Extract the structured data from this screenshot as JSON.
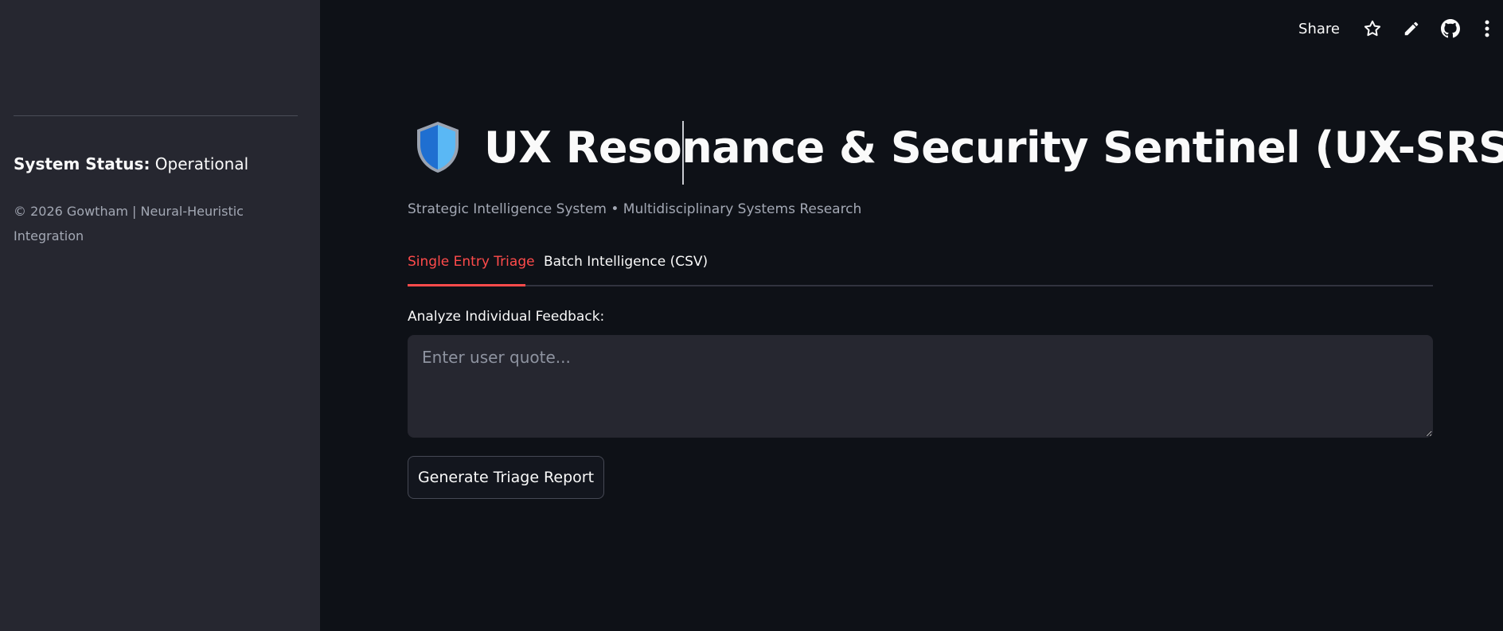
{
  "sidebar": {
    "status_label": "System Status:",
    "status_value": "Operational",
    "copyright": "© 2026 Gowtham | Neural-Heuristic Integration"
  },
  "toolbar": {
    "share_label": "Share",
    "icons": [
      "star-icon",
      "pencil-icon",
      "github-icon",
      "more-vertical-icon"
    ]
  },
  "main": {
    "title_icon": "shield-icon",
    "title": "UX Resonance & Security Sentinel (UX-SRS)",
    "subtitle": "Strategic Intelligence System • Multidisciplinary Systems Research",
    "tabs": [
      {
        "label": "Single Entry Triage",
        "active": true
      },
      {
        "label": "Batch Intelligence (CSV)",
        "active": false
      }
    ],
    "input_label": "Analyze Individual Feedback:",
    "input_placeholder": "Enter user quote...",
    "input_value": "",
    "button_label": "Generate Triage Report"
  },
  "colors": {
    "background": "#0e1117",
    "sidebar": "#262730",
    "accent": "#ff4b4b",
    "text": "#fafafa",
    "muted": "#a3a8b4"
  }
}
